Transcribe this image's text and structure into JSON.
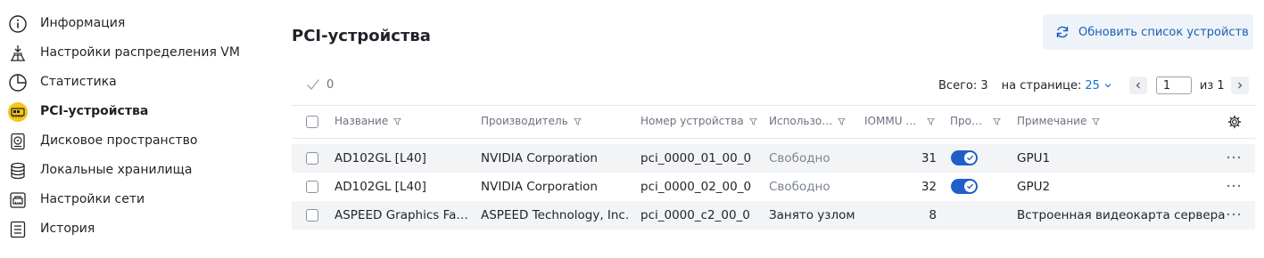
{
  "sidebar": {
    "items": [
      {
        "label": "Информация",
        "icon": "info-icon",
        "active": false
      },
      {
        "label": "Настройки распределения VM",
        "icon": "distribution-icon",
        "active": false
      },
      {
        "label": "Статистика",
        "icon": "pie-chart-icon",
        "active": false
      },
      {
        "label": "PCI-устройства",
        "icon": "pci-card-icon",
        "active": true
      },
      {
        "label": "Дисковое пространство",
        "icon": "disk-icon",
        "active": false
      },
      {
        "label": "Локальные хранилища",
        "icon": "database-icon",
        "active": false
      },
      {
        "label": "Настройки сети",
        "icon": "network-icon",
        "active": false
      },
      {
        "label": "История",
        "icon": "history-icon",
        "active": false
      }
    ]
  },
  "page": {
    "title": "PCI-устройства",
    "refresh_label": "Обновить список устройств"
  },
  "toolbar": {
    "selected_count": "0",
    "total_label": "Всего: 3",
    "per_page_label": "на странице:",
    "per_page_value": "25",
    "page_value": "1",
    "of_label": "из 1"
  },
  "table": {
    "columns": [
      "Название",
      "Производитель",
      "Номер устройства",
      "Использо…",
      "IOMMU …",
      "Про…",
      "Примечание"
    ],
    "rows": [
      {
        "name": "AD102GL [L40]",
        "vendor": "NVIDIA Corporation",
        "device": "pci_0000_01_00_0",
        "usage": "Свободно",
        "usage_muted": true,
        "iommu": "31",
        "passthrough": true,
        "note": "GPU1"
      },
      {
        "name": "AD102GL [L40]",
        "vendor": "NVIDIA Corporation",
        "device": "pci_0000_02_00_0",
        "usage": "Свободно",
        "usage_muted": true,
        "iommu": "32",
        "passthrough": true,
        "note": "GPU2"
      },
      {
        "name": "ASPEED Graphics Fa…",
        "vendor": "ASPEED Technology, Inc.",
        "device": "pci_0000_c2_00_0",
        "usage": "Занято узлом",
        "usage_muted": false,
        "iommu": "8",
        "passthrough": false,
        "note": "Встроенная видеокарта сервера"
      }
    ]
  },
  "colors": {
    "accent": "#1a6fd6",
    "toggle_on": "#1f5fc7",
    "active_icon_bg": "#f5c518"
  }
}
